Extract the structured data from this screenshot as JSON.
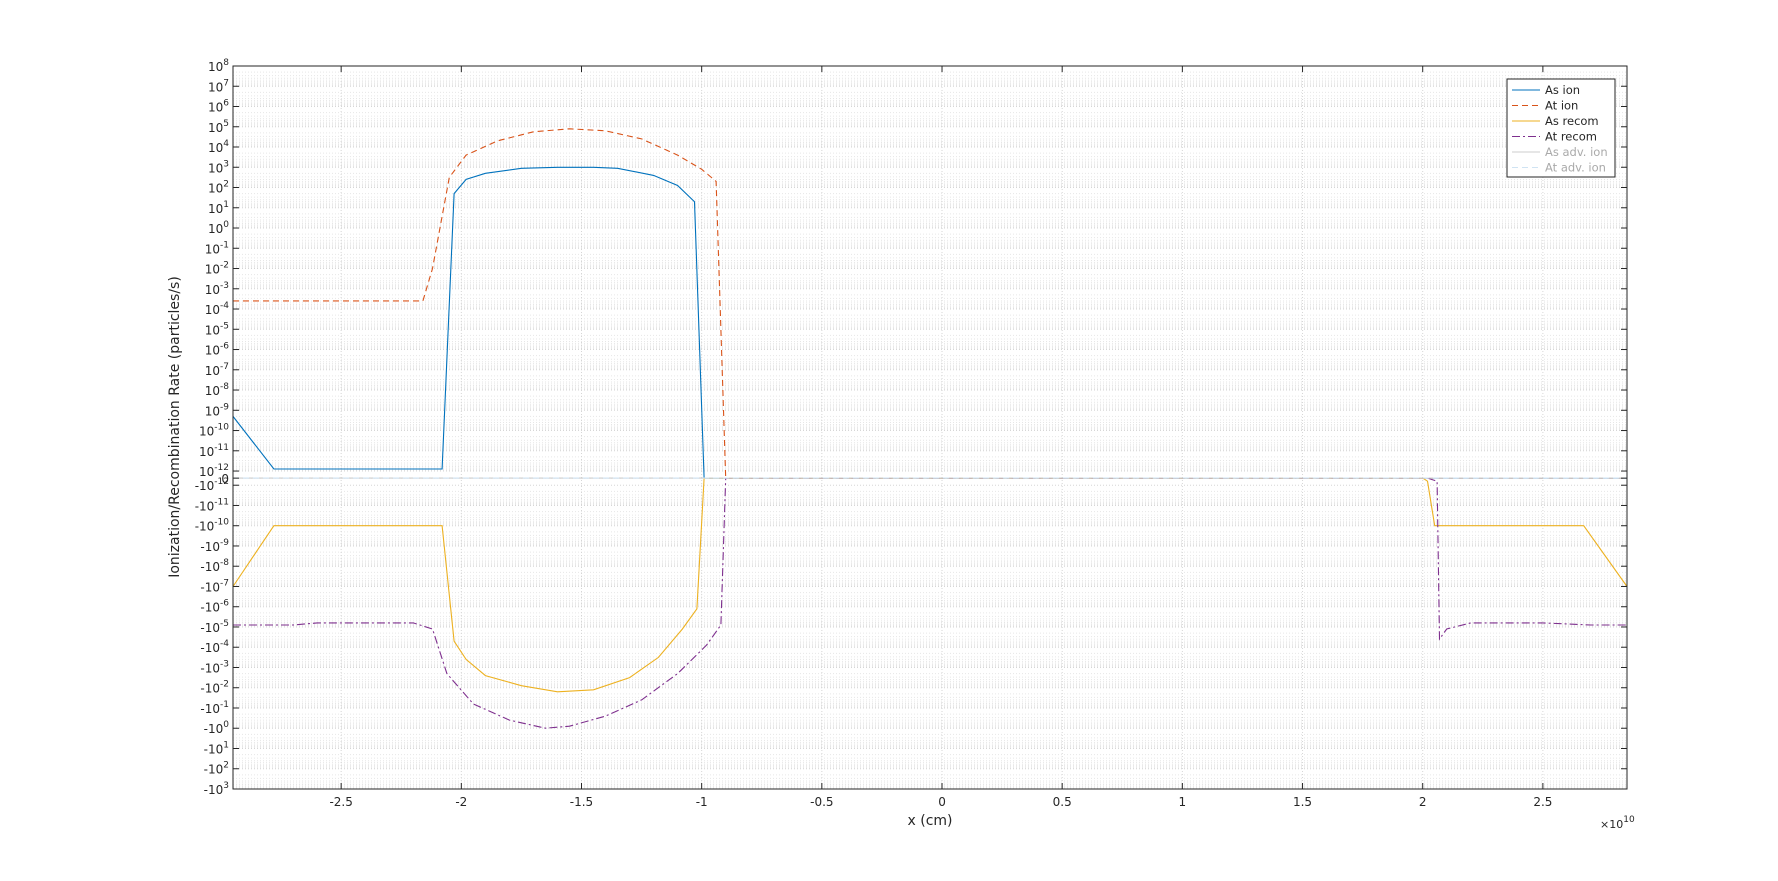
{
  "chart_data": {
    "type": "line",
    "xlabel": "x (cm)",
    "ylabel": "Ionization/Recombination Rate (particles/s)",
    "x_exponent_label": "×10",
    "x_exponent_power": "10",
    "xlim": [
      -2.95,
      2.85
    ],
    "x_ticks": [
      -2.5,
      -2,
      -1.5,
      -1,
      -0.5,
      0,
      0.5,
      1,
      1.5,
      2,
      2.5
    ],
    "x_tick_labels": [
      "-2.5",
      "-2",
      "-1.5",
      "-1",
      "-0.5",
      "0",
      "0.5",
      "1",
      "1.5",
      "2",
      "2.5"
    ],
    "y_scale": "symlog",
    "y_tick_labels": [
      {
        "base": "10",
        "exp": "8",
        "pos": 8
      },
      {
        "base": "10",
        "exp": "7",
        "pos": 7
      },
      {
        "base": "10",
        "exp": "6",
        "pos": 6
      },
      {
        "base": "10",
        "exp": "5",
        "pos": 5
      },
      {
        "base": "10",
        "exp": "4",
        "pos": 4
      },
      {
        "base": "10",
        "exp": "3",
        "pos": 3
      },
      {
        "base": "10",
        "exp": "2",
        "pos": 2
      },
      {
        "base": "10",
        "exp": "1",
        "pos": 1
      },
      {
        "base": "10",
        "exp": "0",
        "pos": 0
      },
      {
        "base": "10",
        "exp": "-1",
        "pos": -1
      },
      {
        "base": "10",
        "exp": "-2",
        "pos": -2
      },
      {
        "base": "10",
        "exp": "-3",
        "pos": -3
      },
      {
        "base": "10",
        "exp": "-4",
        "pos": -4
      },
      {
        "base": "10",
        "exp": "-5",
        "pos": -5
      },
      {
        "base": "10",
        "exp": "-6",
        "pos": -6
      },
      {
        "base": "10",
        "exp": "-7",
        "pos": -7
      },
      {
        "base": "10",
        "exp": "-8",
        "pos": -8
      },
      {
        "base": "10",
        "exp": "-9",
        "pos": -9
      },
      {
        "base": "10",
        "exp": "-10",
        "pos": -10
      },
      {
        "base": "10",
        "exp": "-11",
        "pos": -11
      },
      {
        "base": "10",
        "exp": "-12",
        "pos": -12
      },
      {
        "base": "0",
        "exp": "",
        "pos": -12.35
      },
      {
        "base": "-10",
        "exp": "-12",
        "pos": -12.7
      },
      {
        "base": "-10",
        "exp": "-11",
        "pos": -13.7
      },
      {
        "base": "-10",
        "exp": "-10",
        "pos": -14.7
      },
      {
        "base": "-10",
        "exp": "-9",
        "pos": -15.7
      },
      {
        "base": "-10",
        "exp": "-8",
        "pos": -16.7
      },
      {
        "base": "-10",
        "exp": "-7",
        "pos": -17.7
      },
      {
        "base": "-10",
        "exp": "-6",
        "pos": -18.7
      },
      {
        "base": "-10",
        "exp": "-5",
        "pos": -19.7
      },
      {
        "base": "-10",
        "exp": "-4",
        "pos": -20.7
      },
      {
        "base": "-10",
        "exp": "-3",
        "pos": -21.7
      },
      {
        "base": "-10",
        "exp": "-2",
        "pos": -22.7
      },
      {
        "base": "-10",
        "exp": "-1",
        "pos": -23.7
      },
      {
        "base": "-10",
        "exp": "0",
        "pos": -24.7
      },
      {
        "base": "-10",
        "exp": "1",
        "pos": -25.7
      },
      {
        "base": "-10",
        "exp": "2",
        "pos": -26.7
      },
      {
        "base": "-10",
        "exp": "3",
        "pos": -27.7
      }
    ],
    "ylim_pos": [
      8,
      -27.7
    ],
    "grid": true,
    "legend_position": "top-right",
    "series": [
      {
        "name": "As ion",
        "color": "#0072BD",
        "dash": "solid",
        "points": [
          [
            -2.95,
            -9.3
          ],
          [
            -2.78,
            -11.9
          ],
          [
            -2.4,
            -11.9
          ],
          [
            -2.08,
            -11.9
          ],
          [
            -2.03,
            1.7
          ],
          [
            -1.98,
            2.4
          ],
          [
            -1.9,
            2.7
          ],
          [
            -1.75,
            2.95
          ],
          [
            -1.6,
            3.0
          ],
          [
            -1.45,
            3.0
          ],
          [
            -1.35,
            2.95
          ],
          [
            -1.2,
            2.6
          ],
          [
            -1.1,
            2.1
          ],
          [
            -1.03,
            1.3
          ],
          [
            -0.99,
            -12.35
          ],
          [
            2.85,
            -12.35
          ]
        ]
      },
      {
        "name": "At ion",
        "color": "#D95319",
        "dash": "dashed",
        "points": [
          [
            -2.95,
            -3.6
          ],
          [
            -2.6,
            -3.6
          ],
          [
            -2.3,
            -3.6
          ],
          [
            -2.16,
            -3.6
          ],
          [
            -2.12,
            -2.0
          ],
          [
            -2.05,
            2.5
          ],
          [
            -1.98,
            3.6
          ],
          [
            -1.85,
            4.3
          ],
          [
            -1.7,
            4.75
          ],
          [
            -1.55,
            4.9
          ],
          [
            -1.4,
            4.8
          ],
          [
            -1.25,
            4.4
          ],
          [
            -1.1,
            3.6
          ],
          [
            -1.0,
            2.9
          ],
          [
            -0.94,
            2.3
          ],
          [
            -0.9,
            -12.35
          ],
          [
            2.85,
            -12.35
          ]
        ]
      },
      {
        "name": "As recom",
        "color": "#EDB120",
        "dash": "solid",
        "points": [
          [
            -2.95,
            -17.7
          ],
          [
            -2.78,
            -14.7
          ],
          [
            -2.4,
            -14.7
          ],
          [
            -2.08,
            -14.7
          ],
          [
            -2.03,
            -20.4
          ],
          [
            -1.98,
            -21.3
          ],
          [
            -1.9,
            -22.1
          ],
          [
            -1.75,
            -22.6
          ],
          [
            -1.6,
            -22.9
          ],
          [
            -1.45,
            -22.8
          ],
          [
            -1.3,
            -22.2
          ],
          [
            -1.18,
            -21.2
          ],
          [
            -1.08,
            -19.8
          ],
          [
            -1.02,
            -18.8
          ],
          [
            -0.99,
            -12.35
          ],
          [
            2.0,
            -12.35
          ],
          [
            2.02,
            -12.5
          ],
          [
            2.05,
            -14.7
          ],
          [
            2.2,
            -14.7
          ],
          [
            2.67,
            -14.7
          ],
          [
            2.85,
            -17.7
          ]
        ]
      },
      {
        "name": "At recom",
        "color": "#7E2F8E",
        "dash": "dashdot",
        "points": [
          [
            -2.95,
            -19.6
          ],
          [
            -2.7,
            -19.6
          ],
          [
            -2.6,
            -19.5
          ],
          [
            -2.4,
            -19.5
          ],
          [
            -2.2,
            -19.5
          ],
          [
            -2.12,
            -19.8
          ],
          [
            -2.06,
            -22.0
          ],
          [
            -1.95,
            -23.5
          ],
          [
            -1.8,
            -24.3
          ],
          [
            -1.65,
            -24.7
          ],
          [
            -1.55,
            -24.6
          ],
          [
            -1.4,
            -24.1
          ],
          [
            -1.25,
            -23.3
          ],
          [
            -1.1,
            -22.0
          ],
          [
            -0.98,
            -20.6
          ],
          [
            -0.92,
            -19.6
          ],
          [
            -0.9,
            -12.35
          ],
          [
            2.02,
            -12.35
          ],
          [
            2.06,
            -12.5
          ],
          [
            2.07,
            -20.3
          ],
          [
            2.1,
            -19.8
          ],
          [
            2.2,
            -19.5
          ],
          [
            2.5,
            -19.5
          ],
          [
            2.7,
            -19.6
          ],
          [
            2.85,
            -19.6
          ]
        ]
      },
      {
        "name": "As adv. ion",
        "color": "#cccccc",
        "dash": "solid",
        "legend_text_color": "#aaaaaa",
        "points": [
          [
            -2.95,
            -12.35
          ],
          [
            2.85,
            -12.35
          ]
        ]
      },
      {
        "name": "At adv. ion",
        "color": "#cfe3f3",
        "dash": "dashed",
        "legend_text_color": "#aaaaaa",
        "points": [
          [
            -2.95,
            -12.35
          ],
          [
            2.85,
            -12.35
          ]
        ]
      }
    ]
  }
}
